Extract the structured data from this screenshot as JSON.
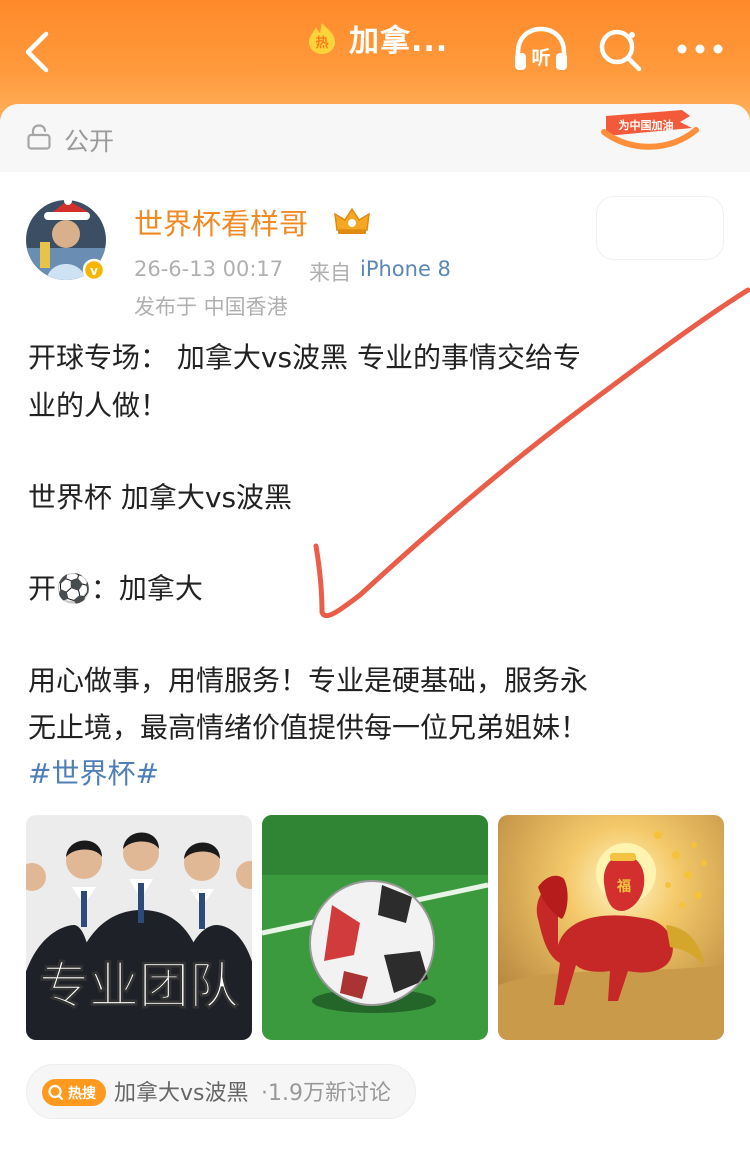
{
  "header": {
    "title": "加拿...",
    "hot_icon_char": "热",
    "listen_label": "听",
    "colors": {
      "gradient_top": "#ff8a2a",
      "gradient_bottom": "#ffb15e"
    }
  },
  "visibility": {
    "label": "公开",
    "badge_text": "为中国加油"
  },
  "post": {
    "author": "世界杯看样哥",
    "time": "26-6-13 00:17",
    "from_label": "来自",
    "device": "iPhone 8",
    "location": "发布于 中国香港",
    "lines": [
      "开球专场： 加拿大vs波黑 专业的事情交给专",
      "业的人做！",
      "世界杯 加拿大vs波黑",
      "开⚽：加拿大",
      "用心做事，用情服务！专业是硬基础，服务永",
      "无止境，最高情绪价值提供每一位兄弟姐妹！"
    ],
    "hashtag": "#世界杯#",
    "images": [
      {
        "caption": "专业团队"
      },
      {
        "caption": ""
      },
      {
        "caption": ""
      }
    ]
  },
  "hot_search": {
    "tag": "热搜",
    "topic": "加拿大vs波黑",
    "count": "·1.9万新讨论"
  },
  "colors": {
    "accent": "#f08a24",
    "link": "#5a86b8",
    "annotation": "#e8503a"
  }
}
